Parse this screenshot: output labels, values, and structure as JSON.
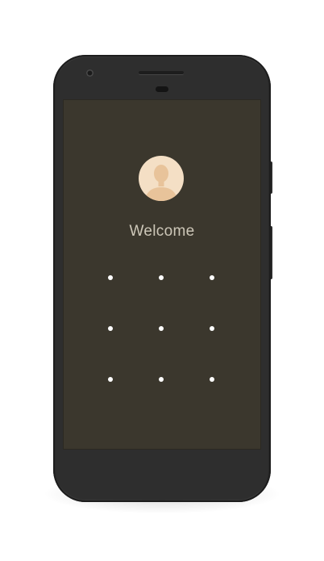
{
  "lock_screen": {
    "greeting": "Welcome",
    "avatar_icon": "user-avatar-icon",
    "pattern_rows": 3,
    "pattern_cols": 3
  },
  "colors": {
    "screen_bg": "#3b372d",
    "phone_body": "#2f2f2f",
    "avatar_bg": "#f4dfc5",
    "avatar_figure": "#e8c39a",
    "greeting_text": "#cdc7b8",
    "pattern_dot": "#ffffff"
  }
}
